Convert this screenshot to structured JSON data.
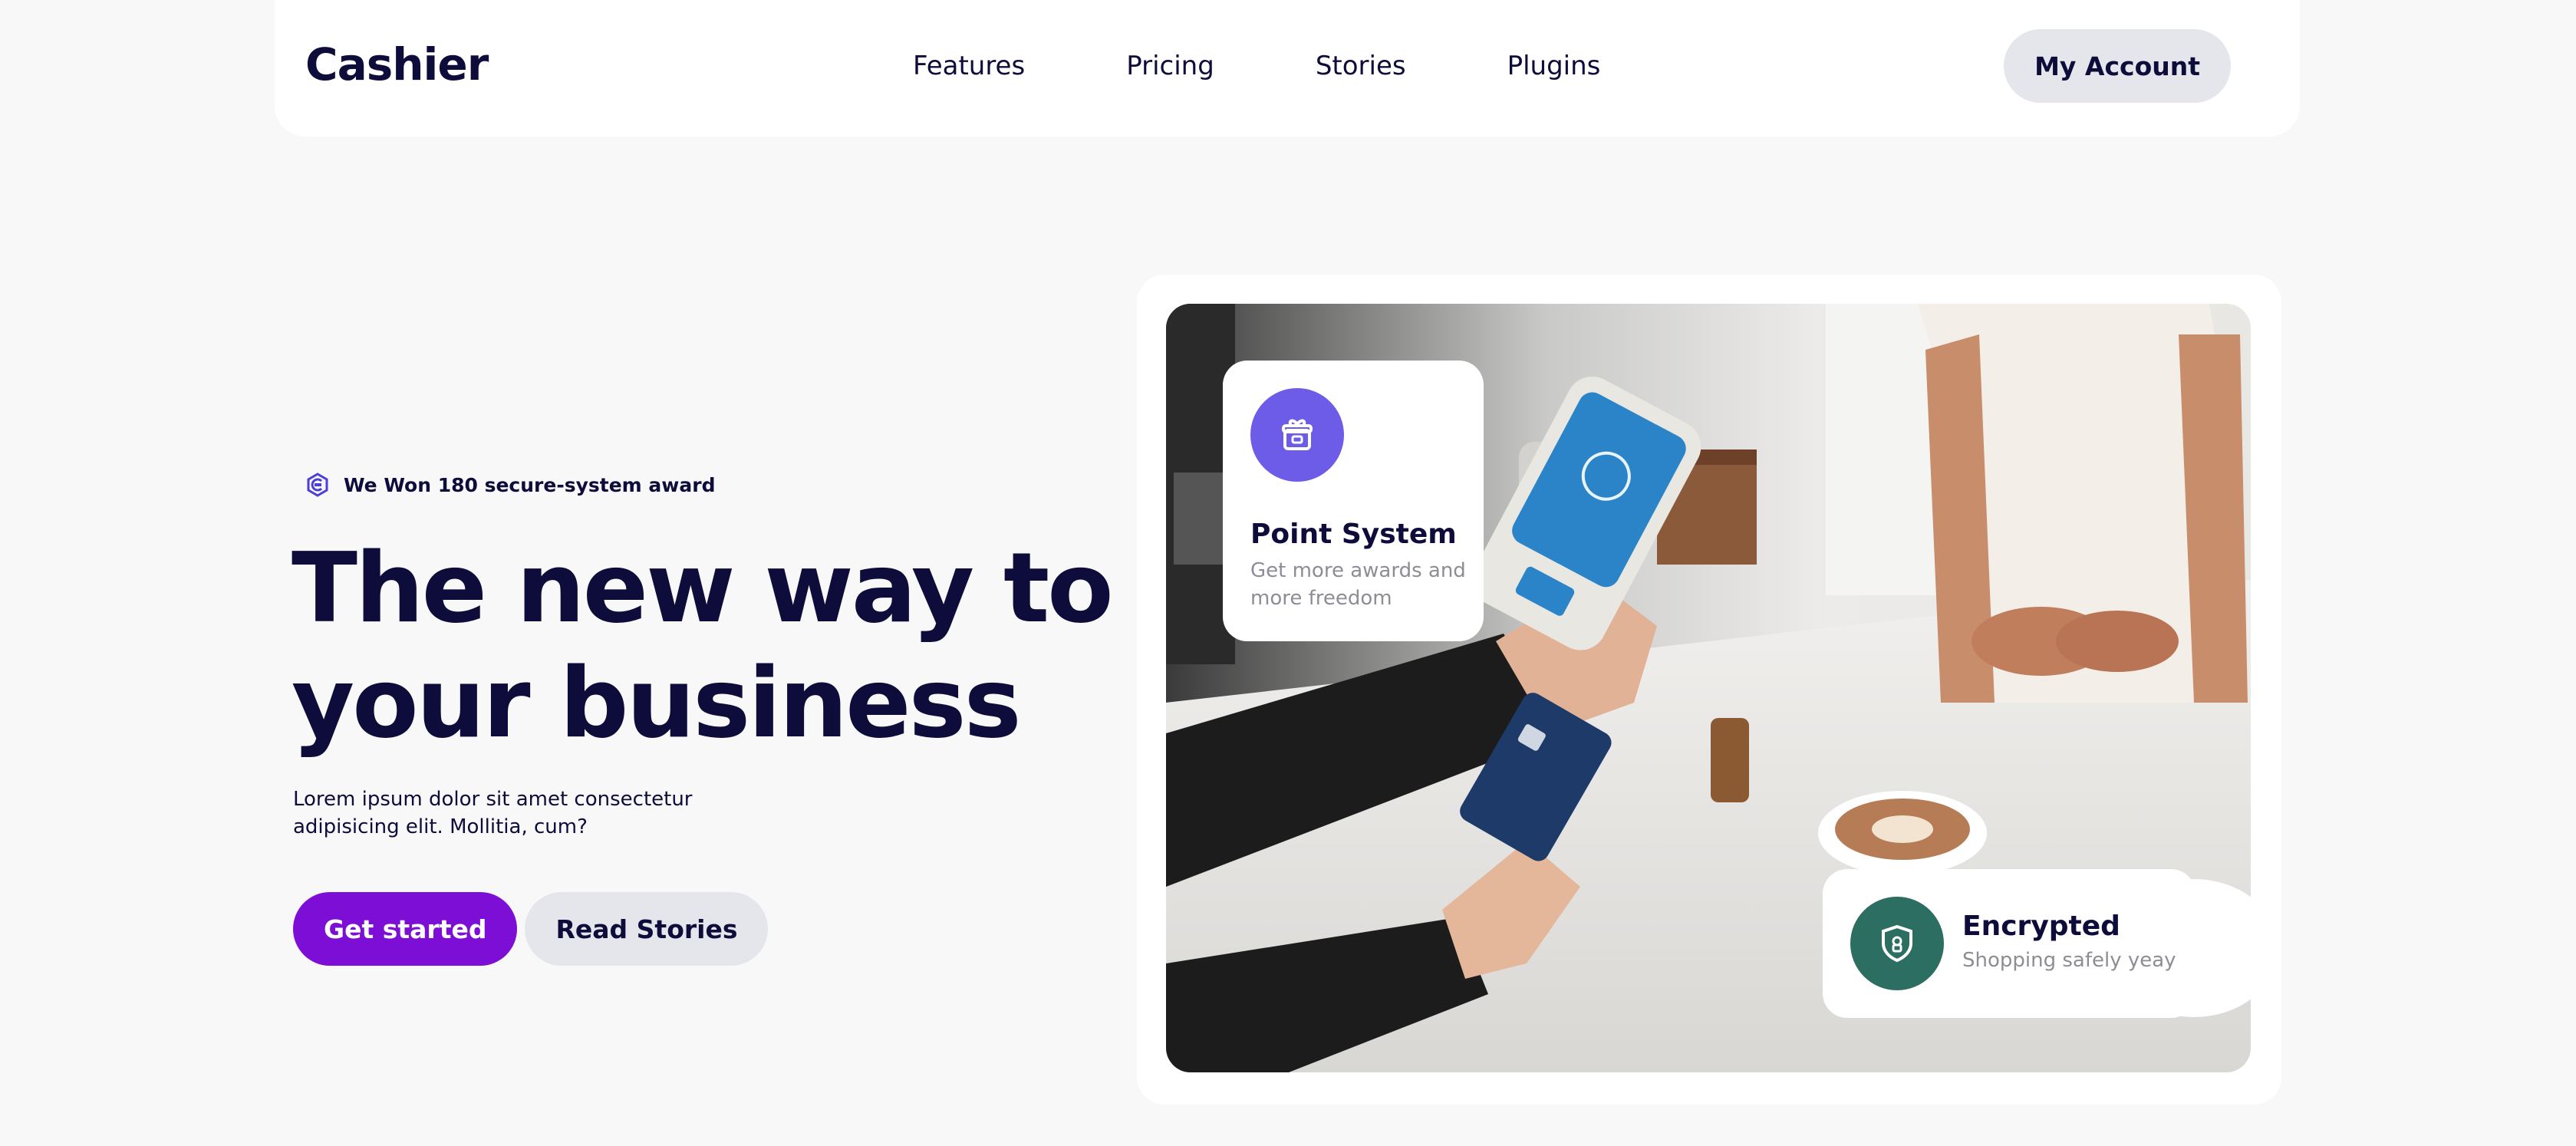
{
  "nav": {
    "logo": "Cashier",
    "links": [
      "Features",
      "Pricing",
      "Stories",
      "Plugins"
    ],
    "account_label": "My Account"
  },
  "hero": {
    "award_text": "We Won 180 secure-system award",
    "headline_line1": "The new way to",
    "headline_line2": "your business",
    "lead": "Lorem ipsum dolor sit amet consectetur adipisicing elit. Mollitia, cum?",
    "primary_cta": "Get started",
    "secondary_cta": "Read Stories"
  },
  "cards": {
    "point": {
      "icon": "gift-icon",
      "title": "Point System",
      "subtitle": "Get more awards and more freedom"
    },
    "encrypted": {
      "icon": "shield-icon",
      "title": "Encrypted",
      "subtitle": "Shopping safely yeay"
    }
  },
  "colors": {
    "brand_dark": "#0d0c3a",
    "primary": "#7d0ed6",
    "secondary_bg": "#e4e6ec",
    "point_icon_bg": "#6c5ce7",
    "encrypted_icon_bg": "#2c6e62"
  }
}
